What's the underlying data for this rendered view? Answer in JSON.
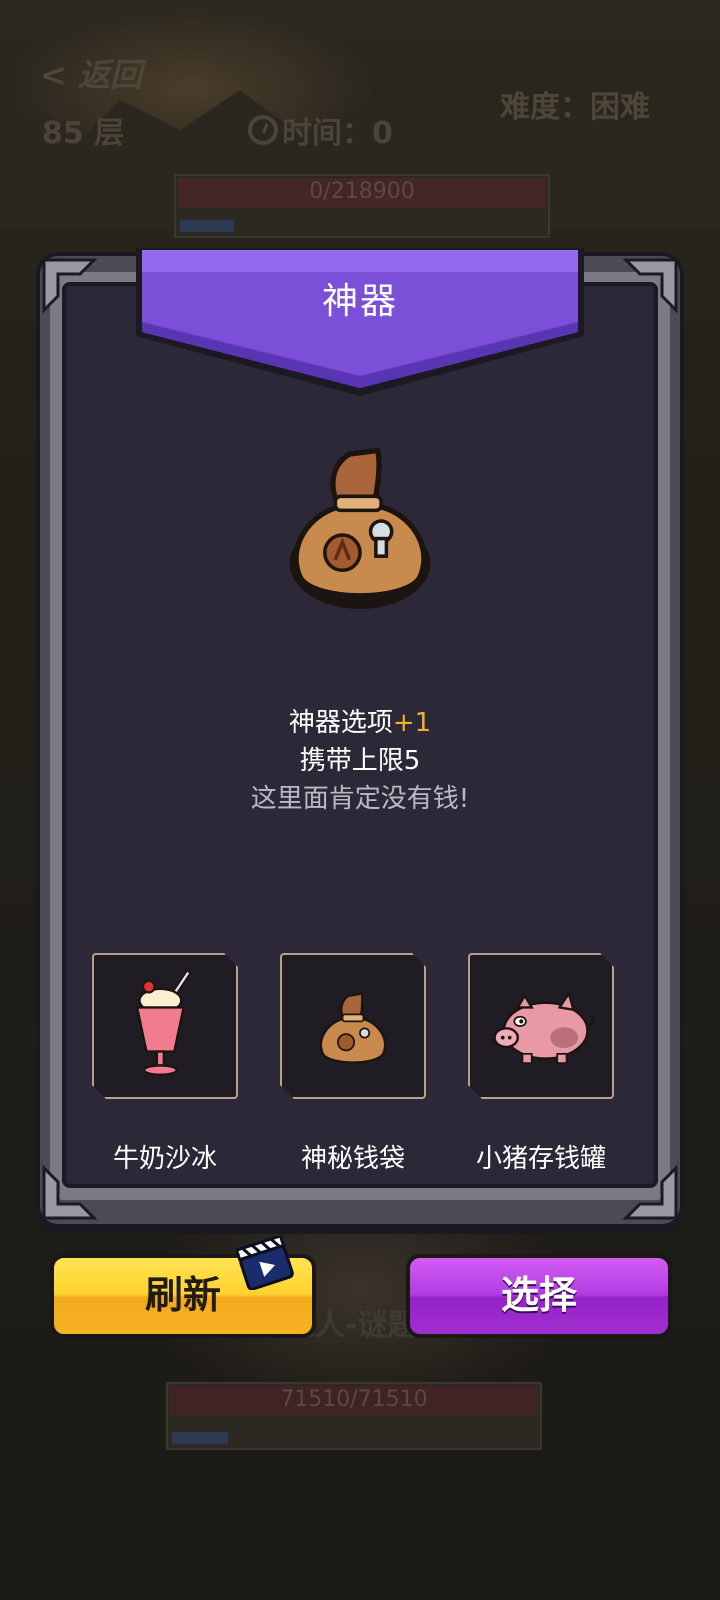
{
  "background": {
    "back_label": "< 返回",
    "floor": "85 层",
    "time_label": "时间：0",
    "difficulty": "难度：困难",
    "boss_hp": "0/218900",
    "boss_hp_fraction": 0.0,
    "enemy_name": "巨人-谜题",
    "enemy_hp": "71510/71510",
    "enemy_hp_fraction": 1.0
  },
  "dialog": {
    "title": "神器",
    "selected_item_icon": "mystery-money-bag-icon",
    "description": {
      "line1_prefix": "神器选项",
      "line1_accent": "+1",
      "line2": "携带上限5",
      "line3": "这里面肯定没有钱!"
    },
    "options": [
      {
        "label": "牛奶沙冰",
        "icon": "milkshake-icon"
      },
      {
        "label": "神秘钱袋",
        "icon": "money-bag-icon",
        "selected": true
      },
      {
        "label": "小猪存钱罐",
        "icon": "piggy-bank-icon"
      }
    ]
  },
  "buttons": {
    "refresh": "刷新",
    "select": "选择",
    "refresh_icon": "video-ad-icon"
  },
  "colors": {
    "accent": "#f0b326",
    "banner": "#7b4fd8",
    "refresh_button": "#ffd22e",
    "select_button": "#b13ce3"
  }
}
